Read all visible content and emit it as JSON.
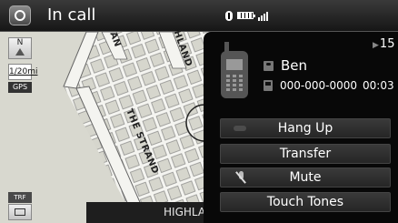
{
  "header": {
    "title": "In call",
    "status_icons": [
      "bluetooth-icon",
      "battery-icon",
      "signal-strength-icon"
    ]
  },
  "map": {
    "scale": "1/20mi",
    "gps_label": "GPS",
    "traffic_label": "TRF",
    "road_labels": {
      "road_upper_left": "AN",
      "road_upper_right": "HLAND",
      "road_diagonal": "THE STRAND"
    },
    "current_street": "HIGHLA",
    "colors": {
      "background": "#d8d8cf",
      "road": "#f4f4f0",
      "road_edge": "#777777"
    }
  },
  "call": {
    "volume": "15",
    "contact_name": "Ben",
    "phone_number": "000-000-0000",
    "duration": "00:03",
    "buttons": {
      "hang_up": "Hang Up",
      "transfer": "Transfer",
      "mute": "Mute",
      "touch_tones": "Touch Tones"
    }
  }
}
